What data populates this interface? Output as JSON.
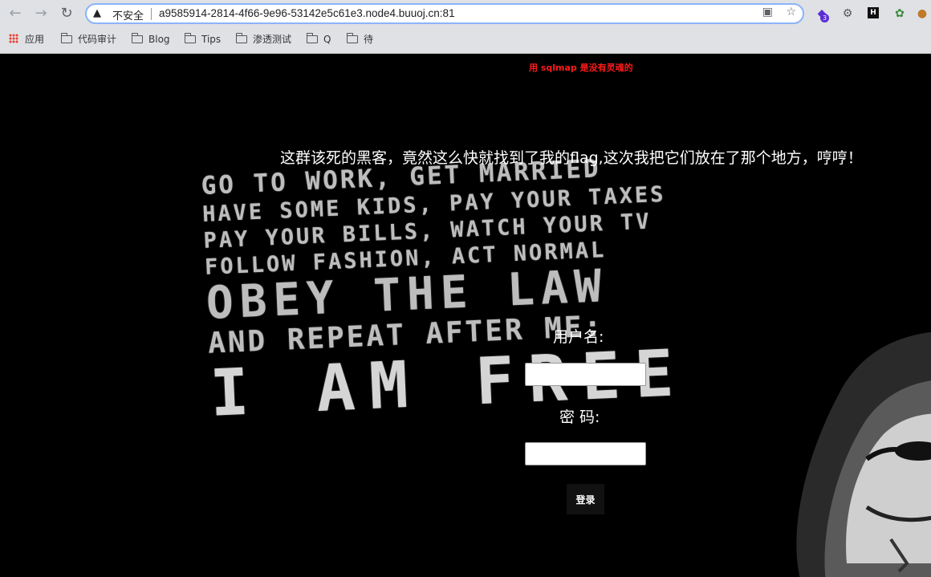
{
  "browser": {
    "security_label": "不安全",
    "url": "a9585914-2814-4f66-9e96-53142e5c61e3.node4.buuoj.cn:81",
    "extension_badge": "3",
    "extension_h_label": "H"
  },
  "bookmarks": [
    {
      "label": "应用"
    },
    {
      "label": "代码审计"
    },
    {
      "label": "Blog"
    },
    {
      "label": "Tips"
    },
    {
      "label": "渗透测试"
    },
    {
      "label": "Q"
    },
    {
      "label": "待"
    }
  ],
  "page": {
    "slogan": "用 sqlmap 是没有灵魂的",
    "heading": "这群该死的黑客，竟然这么快就找到了我的flag,这次我把它们放在了那个地方，哼哼！",
    "background_text": [
      "GO TO WORK, GET MARRIED",
      "HAVE SOME KIDS, PAY YOUR TAXES",
      "PAY YOUR BILLS, WATCH YOUR TV",
      "FOLLOW FASHION, ACT NORMAL",
      "OBEY THE LAW",
      "AND REPEAT AFTER ME:",
      "I AM FREE"
    ],
    "form": {
      "username_label": "用户名:",
      "password_label": "密 码:",
      "username_value": "",
      "password_value": "",
      "login_label": "登录"
    }
  }
}
